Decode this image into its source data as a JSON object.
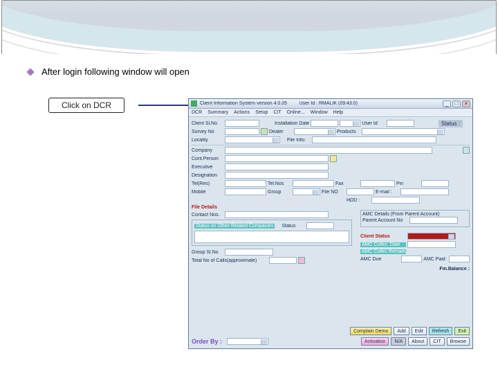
{
  "slide": {
    "bullet": "After login following window will open",
    "callout": "Click on DCR"
  },
  "app": {
    "title_left": "Client Information System  version 4.0.05",
    "title_right": "User Id : RMALIK  (09:43:0)",
    "win_min": "_",
    "win_max": "□",
    "win_close": "×",
    "menu": [
      "DCR",
      "Summary",
      "Actions",
      "Setup",
      "CIT",
      "Online...",
      "Window",
      "Help"
    ],
    "labels": {
      "client_status": "Client Sl.No",
      "installation_date": "Installation Date",
      "user_id": "User Id",
      "status": "Status :",
      "survey_no": "Survey No",
      "dealer": "Dealer",
      "products": "Products",
      "locality": "Locality",
      "file_info": "File Info:",
      "company": "Company",
      "cont_person": "Cont.Person",
      "executive": "Executive",
      "designation": "Designation",
      "tel_res": "Tel(Res)",
      "tel_nos": "Tel.Nos",
      "fax": "Fax",
      "pin": "Pin",
      "mobile": "Mobile",
      "group": "Group",
      "file_no": "File NO",
      "e_mail": "E-mail :",
      "hdd": "HDD :",
      "file_details": "File Details",
      "contact_nos": "Contact Nos.",
      "amc_header": "AMC Details (From Parent Account)",
      "parent_acc": "Parent Account No",
      "client_sts": "Client Status",
      "amc_date": "AMC Collec. Date",
      "amc_rem": "AMC Collec Remarks",
      "amc_due": "AMC Due",
      "amc_paid": "AMC Paid",
      "fin_balance": "Fin.Balance :",
      "status_related": "Status on Other Related Companies",
      "status_lbl": "Status",
      "group_slno": "Group Sl.No",
      "total_calls": "Total No of Calls(approximate)"
    },
    "bottom": {
      "order_by": "Order By :",
      "btns": {
        "complain": "Complain Demo",
        "add": "Add",
        "edit": "Edit",
        "refresh": "Refresh",
        "exit": "Exit",
        "activation": "Activation",
        "na": "N/A",
        "about": "About",
        "cit": "CIT",
        "browse": "Browse"
      }
    }
  }
}
